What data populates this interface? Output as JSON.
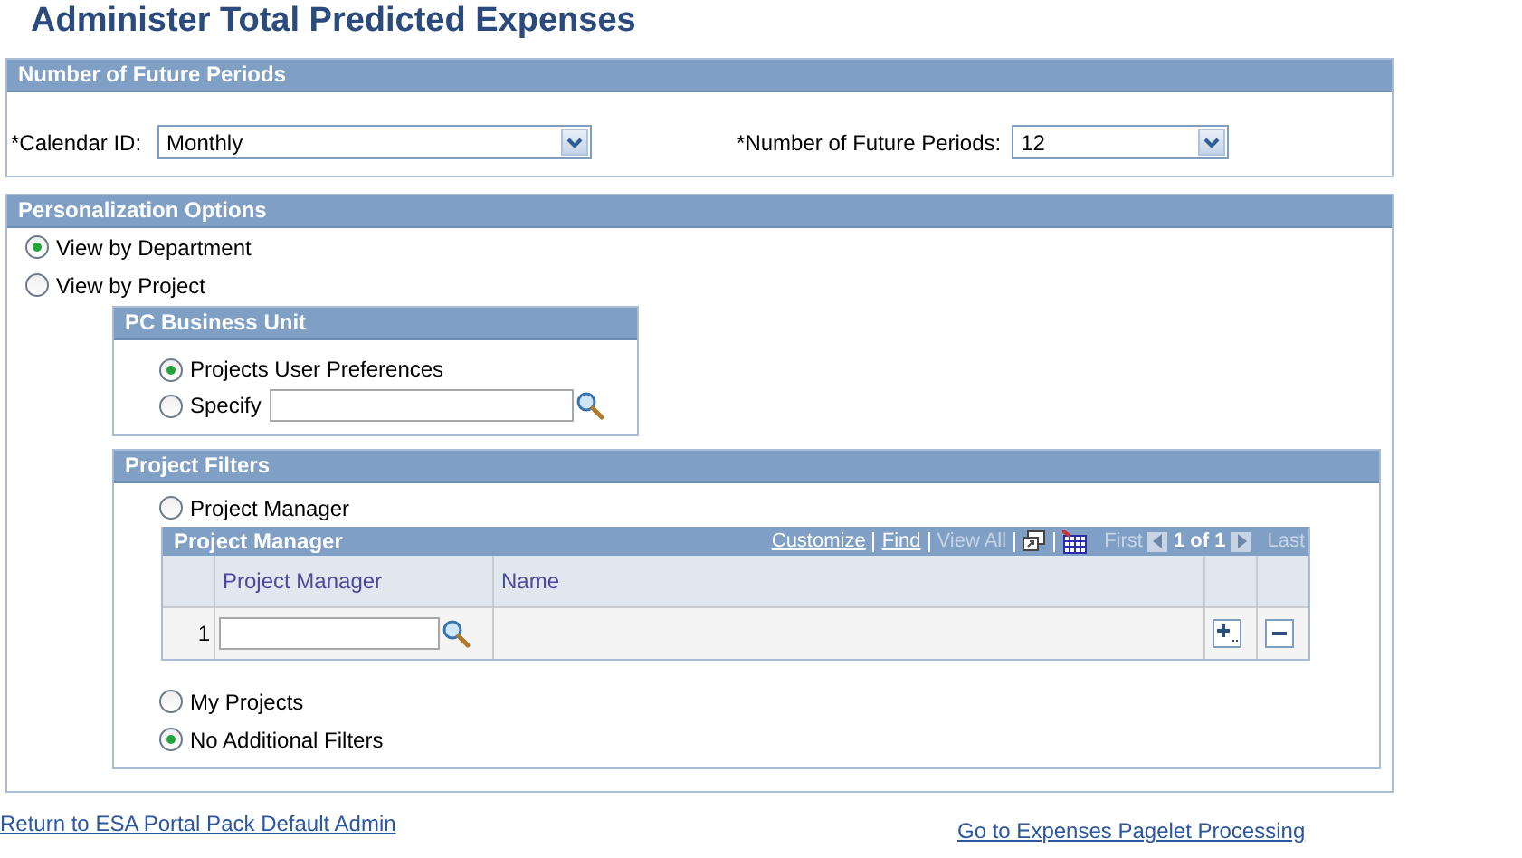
{
  "title": "Administer Total Predicted Expenses",
  "future_periods": {
    "header": "Number of Future Periods",
    "calendar": {
      "label": "*Calendar ID:",
      "value": "Monthly"
    },
    "periods": {
      "label": "*Number of Future Periods:",
      "value": "12"
    }
  },
  "personalization": {
    "header": "Personalization Options",
    "view_options": [
      {
        "label": "View by Department",
        "selected": true
      },
      {
        "label": "View by Project",
        "selected": false
      }
    ],
    "business_unit": {
      "header": "PC Business Unit",
      "options": [
        {
          "kind": "plain",
          "label": "Projects User Preferences",
          "selected": true
        },
        {
          "kind": "field",
          "label": "Specify",
          "selected": false
        }
      ]
    },
    "project_filters": {
      "header": "Project Filters",
      "items": [
        {
          "kind": "radio",
          "label": "Project Manager",
          "selected": false
        },
        {
          "kind": "grid",
          "title": "Project Manager",
          "links": [
            {
              "label": "Customize",
              "disabled": false
            },
            {
              "label": "Find",
              "disabled": false
            },
            {
              "label": "View All",
              "disabled": true
            }
          ],
          "first": "First",
          "count": "1 of 1",
          "last": "Last",
          "columns": [
            "Project Manager",
            "Name"
          ],
          "rows": [
            {
              "number": "1"
            }
          ]
        },
        {
          "kind": "radio",
          "label": "My Projects",
          "selected": false
        },
        {
          "kind": "radio",
          "label": "No Additional Filters",
          "selected": true
        }
      ]
    }
  },
  "footer_links": [
    "Return to ESA Portal Pack Default Admin",
    "Go to Expenses Pagelet Processing"
  ]
}
